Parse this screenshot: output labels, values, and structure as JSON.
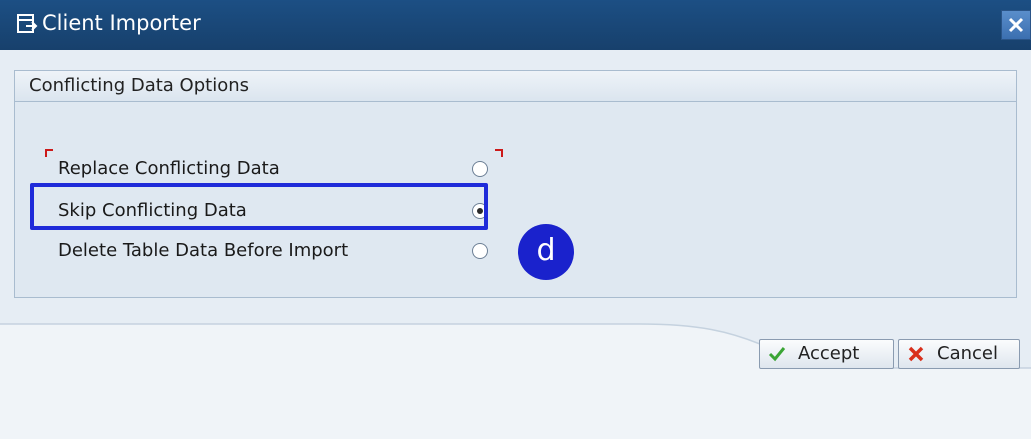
{
  "window": {
    "title": "Client Importer",
    "close_glyph": "✕"
  },
  "group": {
    "title": "Conflicting Data Options"
  },
  "options": [
    {
      "label": "Replace Conflicting Data",
      "selected": false
    },
    {
      "label": "Skip Conflicting Data",
      "selected": true
    },
    {
      "label": "Delete Table Data Before Import",
      "selected": false
    }
  ],
  "annotation": {
    "badge_text": "d"
  },
  "buttons": {
    "accept_label": "Accept",
    "cancel_label": "Cancel"
  },
  "colors": {
    "titlebar": "#1c4f84",
    "highlight": "#1f2bd9",
    "badge": "#1a22cc",
    "accept_check": "#3aa535",
    "cancel_x": "#d9301c"
  },
  "icons": {
    "title": "window-icon",
    "close": "close-icon",
    "accept": "checkmark-icon",
    "cancel": "cancel-x-icon"
  }
}
